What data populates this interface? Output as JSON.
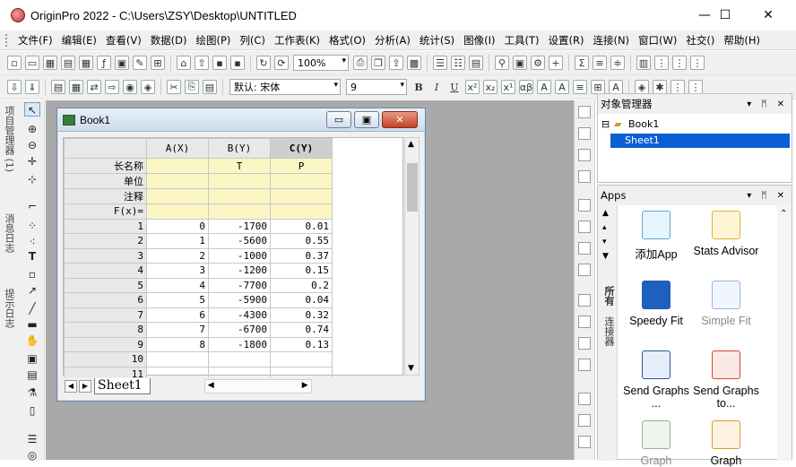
{
  "window": {
    "title": "OriginPro 2022 - C:\\Users\\ZSY\\Desktop\\UNTITLED",
    "controls": {
      "minimize": "—",
      "maximize": "☐",
      "close": "✕"
    }
  },
  "menubar": {
    "items": [
      "文件(F)",
      "编辑(E)",
      "查看(V)",
      "数据(D)",
      "绘图(P)",
      "列(C)",
      "工作表(K)",
      "格式(O)",
      "分析(A)",
      "统计(S)",
      "图像(I)",
      "工具(T)",
      "设置(R)",
      "连接(N)",
      "窗口(W)",
      "社交()",
      "帮助(H)"
    ]
  },
  "toolbar1": {
    "zoom": "100%"
  },
  "toolbar2": {
    "font": "默认: 宋体",
    "font_size": "9",
    "bold": "B",
    "italic": "I",
    "underline": "U"
  },
  "left_panel": {
    "tabs": [
      "项目管理器 (1)",
      "消息日志",
      "提示日志"
    ]
  },
  "book": {
    "title": "Book1",
    "columns": [
      {
        "header": "A(X)",
        "long_name": "",
        "unit": "",
        "comment": ""
      },
      {
        "header": "B(Y)",
        "long_name": "T",
        "unit": "",
        "comment": ""
      },
      {
        "header": "C(Y)",
        "long_name": "P",
        "unit": "",
        "comment": ""
      }
    ],
    "meta_labels": [
      "长名称",
      "单位",
      "注释",
      "F(x)="
    ],
    "rows": [
      {
        "n": "1",
        "a": "0",
        "b": "-1700",
        "c": "0.01"
      },
      {
        "n": "2",
        "a": "1",
        "b": "-5600",
        "c": "0.55"
      },
      {
        "n": "3",
        "a": "2",
        "b": "-1000",
        "c": "0.37"
      },
      {
        "n": "4",
        "a": "3",
        "b": "-1200",
        "c": "0.15"
      },
      {
        "n": "5",
        "a": "4",
        "b": "-7700",
        "c": "0.2"
      },
      {
        "n": "6",
        "a": "5",
        "b": "-5900",
        "c": "0.04"
      },
      {
        "n": "7",
        "a": "6",
        "b": "-4300",
        "c": "0.32"
      },
      {
        "n": "8",
        "a": "7",
        "b": "-6700",
        "c": "0.74"
      },
      {
        "n": "9",
        "a": "8",
        "b": "-1800",
        "c": "0.13"
      },
      {
        "n": "10",
        "a": "",
        "b": "",
        "c": ""
      },
      {
        "n": "11",
        "a": "",
        "b": "",
        "c": ""
      }
    ],
    "sheet_tab": "Sheet1"
  },
  "object_manager": {
    "title": "对象管理器",
    "tree": {
      "book": "Book1",
      "sheet": "Sheet1"
    }
  },
  "apps": {
    "title": "Apps",
    "side_tabs": [
      "所有",
      "连接器"
    ],
    "items": [
      {
        "label": "添加App"
      },
      {
        "label": "Stats Advisor"
      },
      {
        "label": "Speedy Fit"
      },
      {
        "label": "Simple Fit"
      },
      {
        "label": "Send Graphs ..."
      },
      {
        "label": "Send Graphs to..."
      },
      {
        "label": "Graph"
      },
      {
        "label": "Graph"
      }
    ]
  }
}
